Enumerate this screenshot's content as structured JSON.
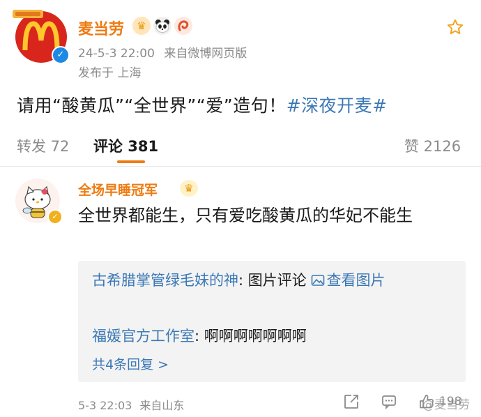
{
  "post": {
    "author_name": "麦当劳",
    "badge_icons": [
      "crown-badge-icon",
      "panda-badge-icon",
      "shrimp-badge-icon"
    ],
    "timestamp": "24-5-3 22:00",
    "source": "来自微博网页版",
    "location": "发布于 上海",
    "text": "请用“酸黄瓜”“全世界”“爱”造句！",
    "hashtag": "#深夜开麦#"
  },
  "tabs": {
    "repost": "转发 72",
    "comment": "评论 381",
    "like": "赞 2126"
  },
  "comment": {
    "author_name": "全场早睡冠军",
    "text": "全世界都能生，只有爱吃酸黄瓜的华妃不能生",
    "replies": [
      {
        "name": "古希腊掌管绿毛妹的神",
        "sep": ": ",
        "text": "图片评论 ",
        "link": "查看图片"
      },
      {
        "name": "福媛官方工作室",
        "sep": ": ",
        "text": "啊啊啊啊啊啊啊"
      }
    ],
    "more_replies": "共4条回复 >",
    "timestamp": "5-3 22:03",
    "source": "来自山东",
    "like_count": "198",
    "watermark": "@麦当劳"
  },
  "colors": {
    "accent": "#ee7b12",
    "link": "#3b78b5",
    "secondary_text": "#8a8a8a",
    "mcd_red": "#d9261c",
    "mcd_yellow": "#ffc72c"
  }
}
